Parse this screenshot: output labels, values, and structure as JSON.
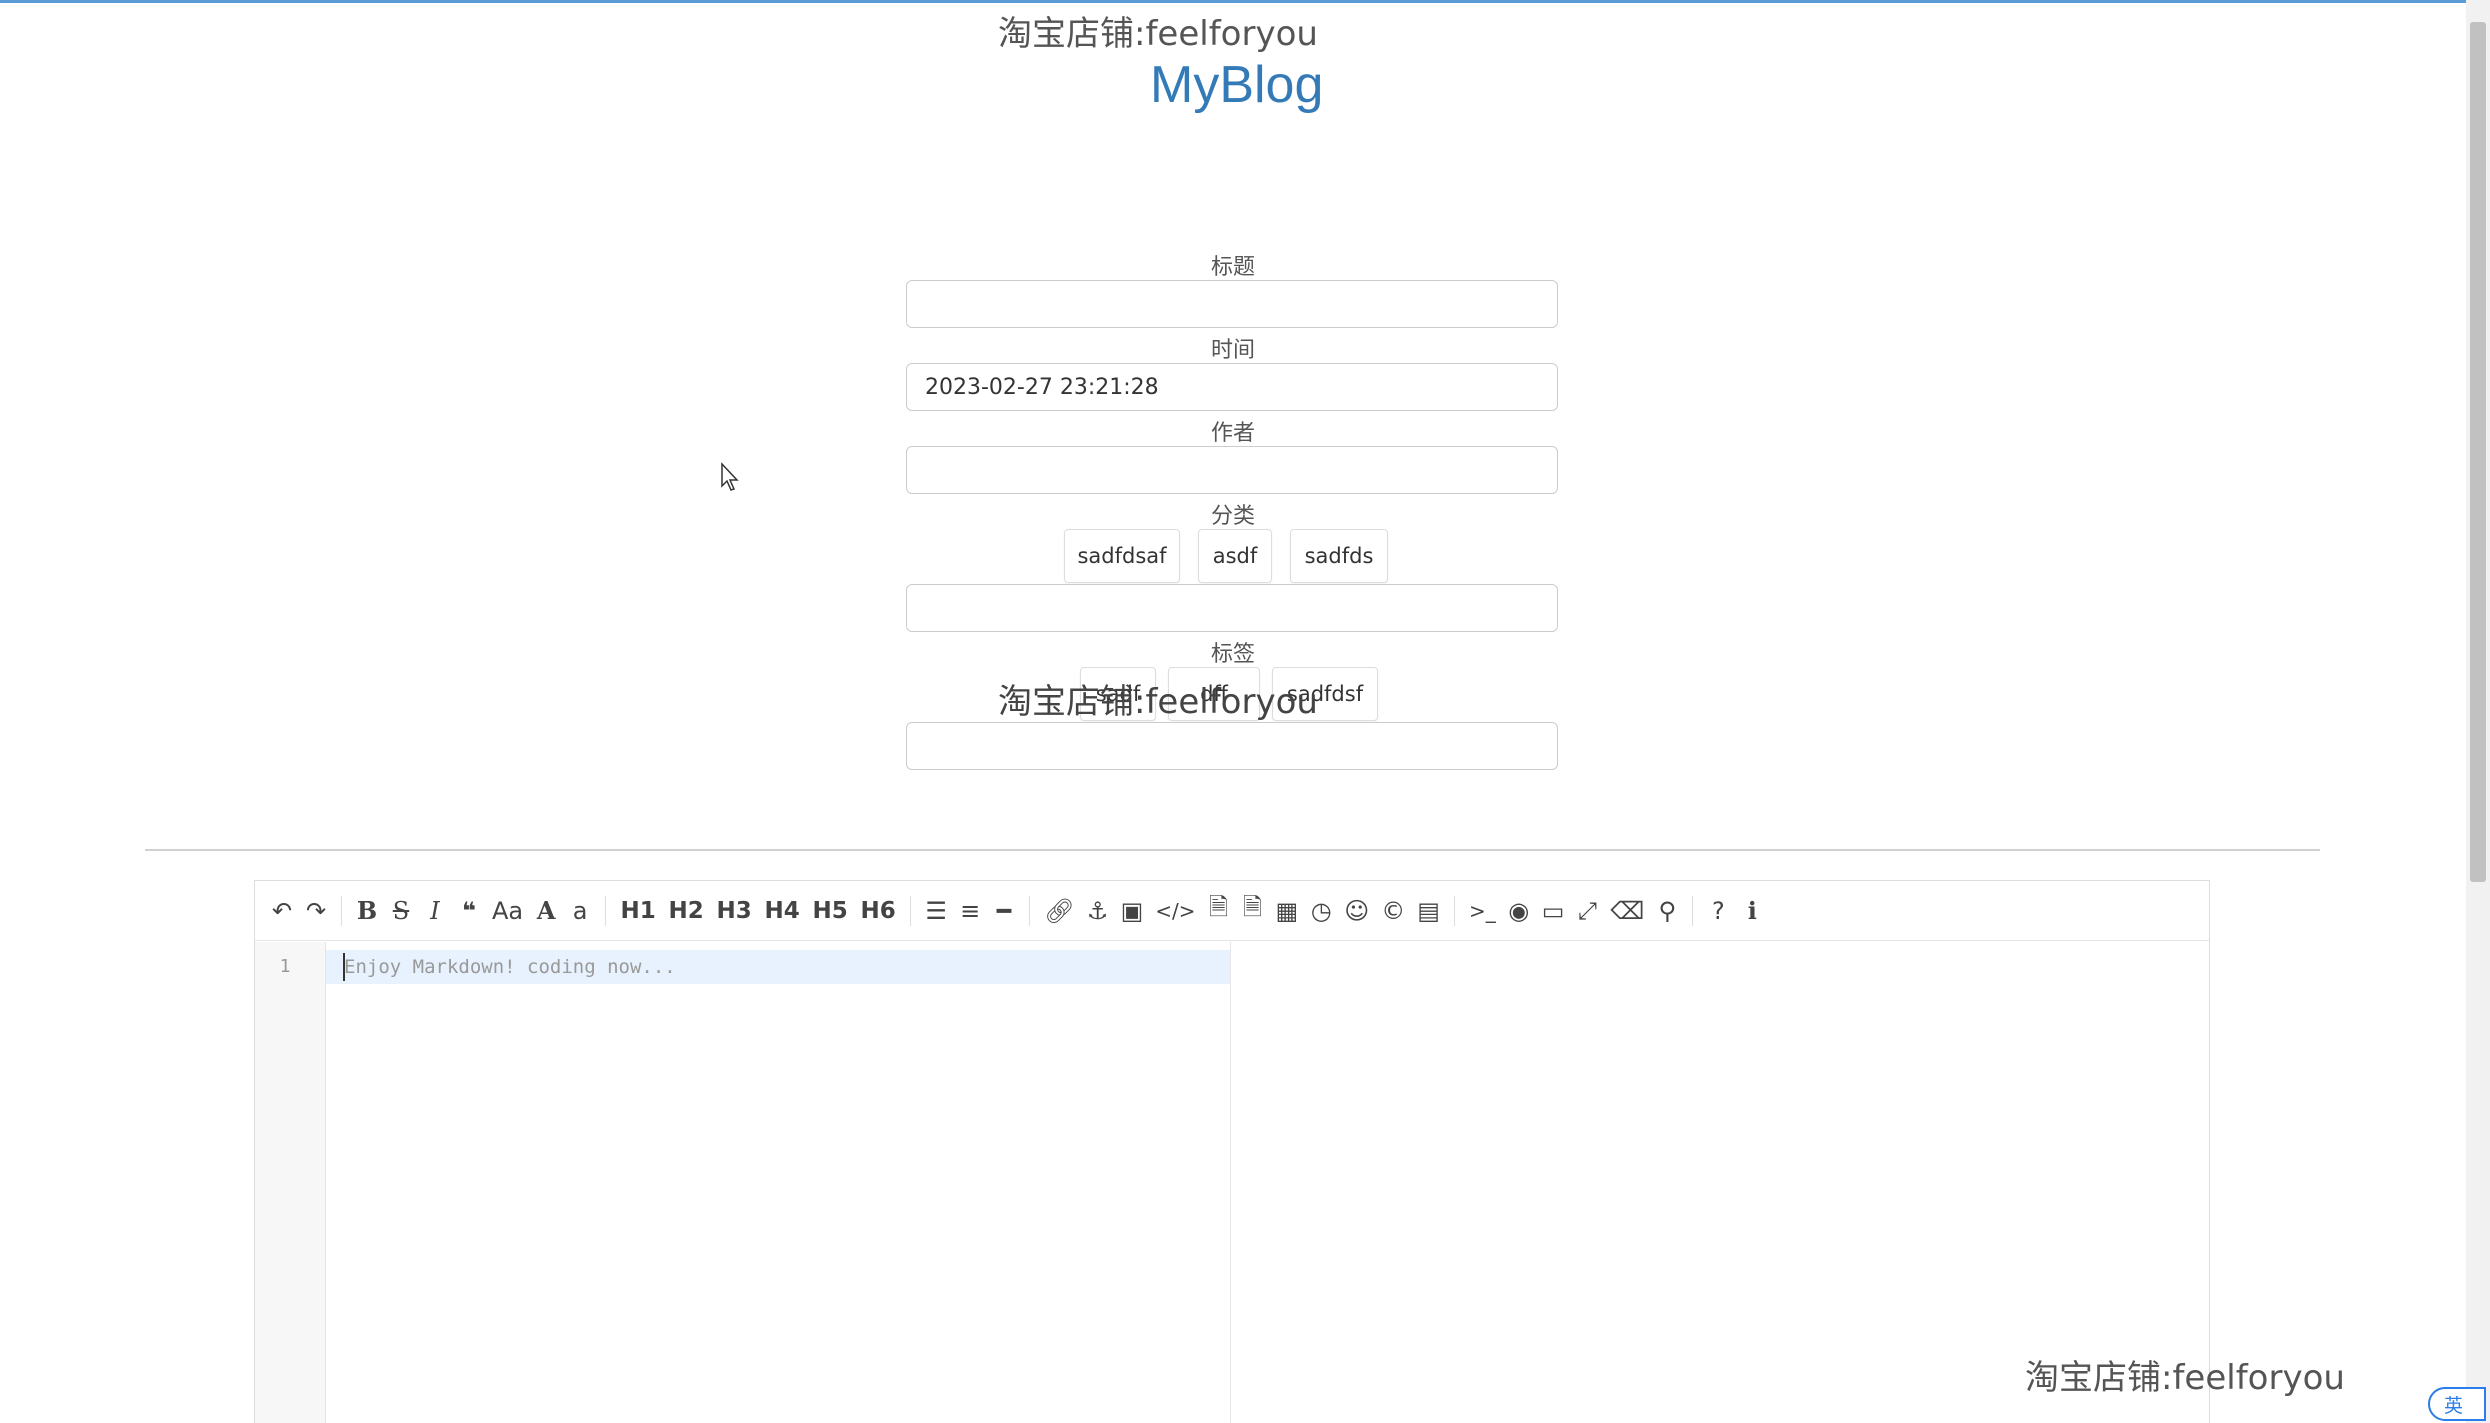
{
  "watermark": "淘宝店铺:feelforyou",
  "brand": "MyBlog",
  "form": {
    "title_label": "标题",
    "title_value": "",
    "time_label": "时间",
    "time_value": "2023-02-27 23:21:28",
    "author_label": "作者",
    "author_value": "",
    "category_label": "分类",
    "categories": [
      "sadfdsaf",
      "asdf",
      "sadfds"
    ],
    "category_input_value": "",
    "tag_label": "标签",
    "tags": [
      "sadf",
      "dff",
      "sadfdsf"
    ],
    "tag_input_value": ""
  },
  "editor": {
    "toolbar": [
      "undo-icon",
      "redo-icon",
      "bold-icon",
      "strikethrough-icon",
      "italic-icon",
      "quote-icon",
      "uppercase-icon",
      "font-size-icon",
      "lowercase-icon",
      "H1",
      "H2",
      "H3",
      "H4",
      "H5",
      "H6",
      "unordered-list-icon",
      "ordered-list-icon",
      "horizontal-rule-icon",
      "link-icon",
      "anchor-icon",
      "image-icon",
      "code-icon",
      "code-file-icon",
      "code-block-icon",
      "table-icon",
      "clock-icon",
      "emoji-icon",
      "copyright-icon",
      "pagebreak-icon",
      "terminal-icon",
      "hide-preview-icon",
      "desktop-icon",
      "fullscreen-icon",
      "eraser-icon",
      "search-icon",
      "help-icon",
      "info-icon"
    ],
    "headings": [
      "H1",
      "H2",
      "H3",
      "H4",
      "H5",
      "H6"
    ],
    "line_number": "1",
    "placeholder": "Enjoy Markdown! coding now..."
  },
  "ime_indicator": "英"
}
